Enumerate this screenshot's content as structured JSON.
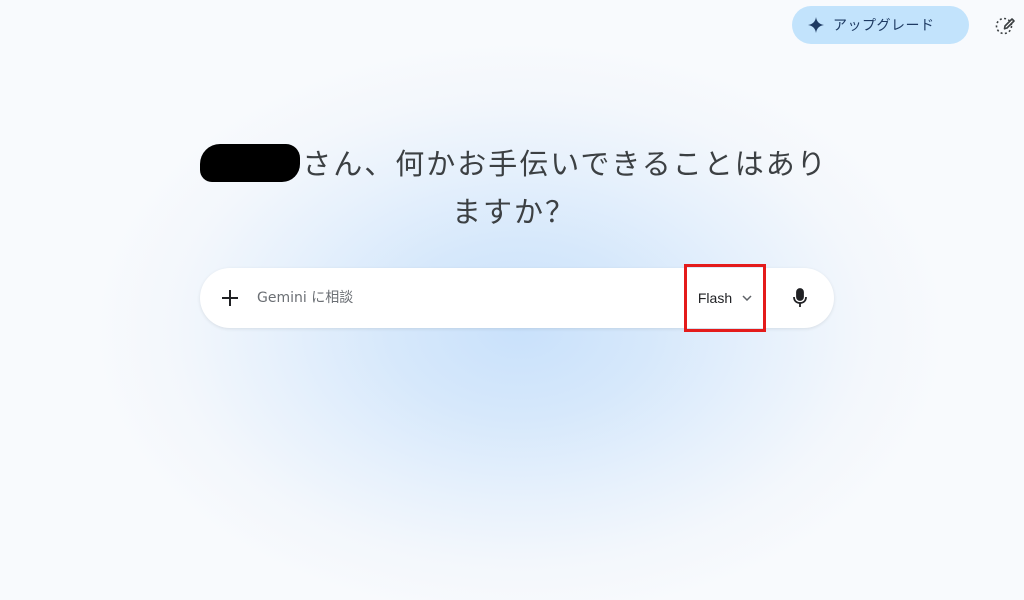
{
  "header": {
    "upgrade_label": "アップグレード",
    "upgrade_icon": "sparkle-icon",
    "new_chat_icon": "edit-icon"
  },
  "greeting": {
    "line1_suffix": "さん、何かお手伝いできることはあり",
    "line2": "ますか？"
  },
  "prompt_bar": {
    "placeholder": "Gemini に相談",
    "value": "",
    "add_icon": "plus-icon",
    "model_selected": "Flash",
    "model_icon": "chevron-down-icon",
    "mic_icon": "microphone-icon"
  },
  "colors": {
    "upgrade_bg": "#c2e3fc",
    "highlight_box": "#e41b1b",
    "sparkle": "#1a73e8"
  }
}
